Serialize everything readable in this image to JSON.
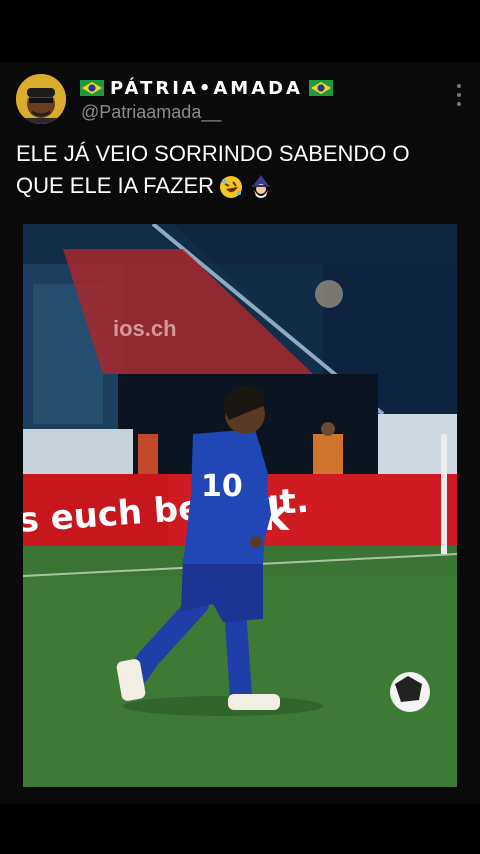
{
  "author": {
    "display_name": "PÁTRIA•AMADA",
    "handle": "@Patriaamada__",
    "flag_icon": "brazil-flag-icon"
  },
  "tweet": {
    "text_line1": "ELE JÁ VEIO SORRINDO SABENDO O",
    "text_line2": "QUE ELE IA FAZER",
    "emojis": [
      "rolling-on-floor-laughing-icon",
      "wizard-icon"
    ]
  },
  "media": {
    "banner_text": "s euch bewegt.",
    "board_text": "ios.ch",
    "jersey_number": "10"
  },
  "colors": {
    "background": "#000000",
    "handle_gray": "#8b8b8b",
    "pitch_green": "#3c7a35",
    "kit_blue": "#1f3fa8",
    "board_red": "#c8161d"
  }
}
